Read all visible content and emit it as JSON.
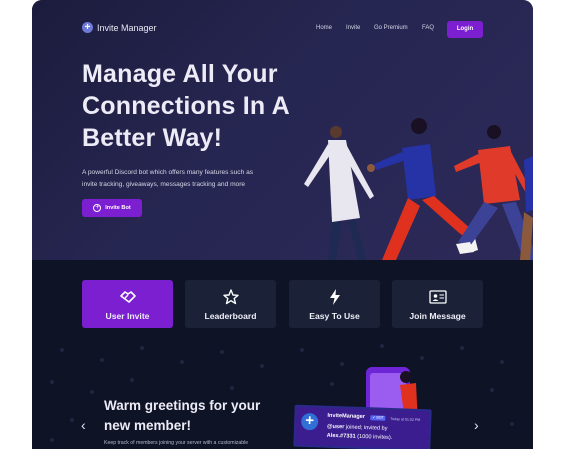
{
  "nav": {
    "brand": "Invite Manager",
    "links": [
      "Home",
      "Invite",
      "Go Premium",
      "FAQ"
    ],
    "login": "Login"
  },
  "hero": {
    "headline_line1": "Manage All Your",
    "headline_line2": "Connections In A",
    "headline_line3": "Better Way!",
    "subtext_line1": "A powerful Discord bot which offers many features such as",
    "subtext_line2": "invite tracking, giveaways, messages tracking and more",
    "invite_button": "Invite Bot"
  },
  "features": [
    {
      "label": "User Invite",
      "icon": "handshake-icon",
      "active": true
    },
    {
      "label": "Leaderboard",
      "icon": "star-icon",
      "active": false
    },
    {
      "label": "Easy To Use",
      "icon": "lightning-icon",
      "active": false
    },
    {
      "label": "Join Message",
      "icon": "id-card-icon",
      "active": false
    }
  ],
  "carousel": {
    "title_line1": "Warm greetings for your",
    "title_line2": "new member!",
    "description": "Keep track of members joining your server with a customizable",
    "message": {
      "author": "InviteManager",
      "badge": "✓ BOT",
      "time": "Today at 01:02 PM",
      "user": "@user",
      "joined_text": " joined; invited by",
      "inviter": "Alex.#7331",
      "invites": " (1000 invites)."
    }
  },
  "colors": {
    "accent": "#7b1fd1",
    "hero_bg": "#262652",
    "dark_bg": "#0f1326",
    "card_bg": "#1b2238"
  }
}
